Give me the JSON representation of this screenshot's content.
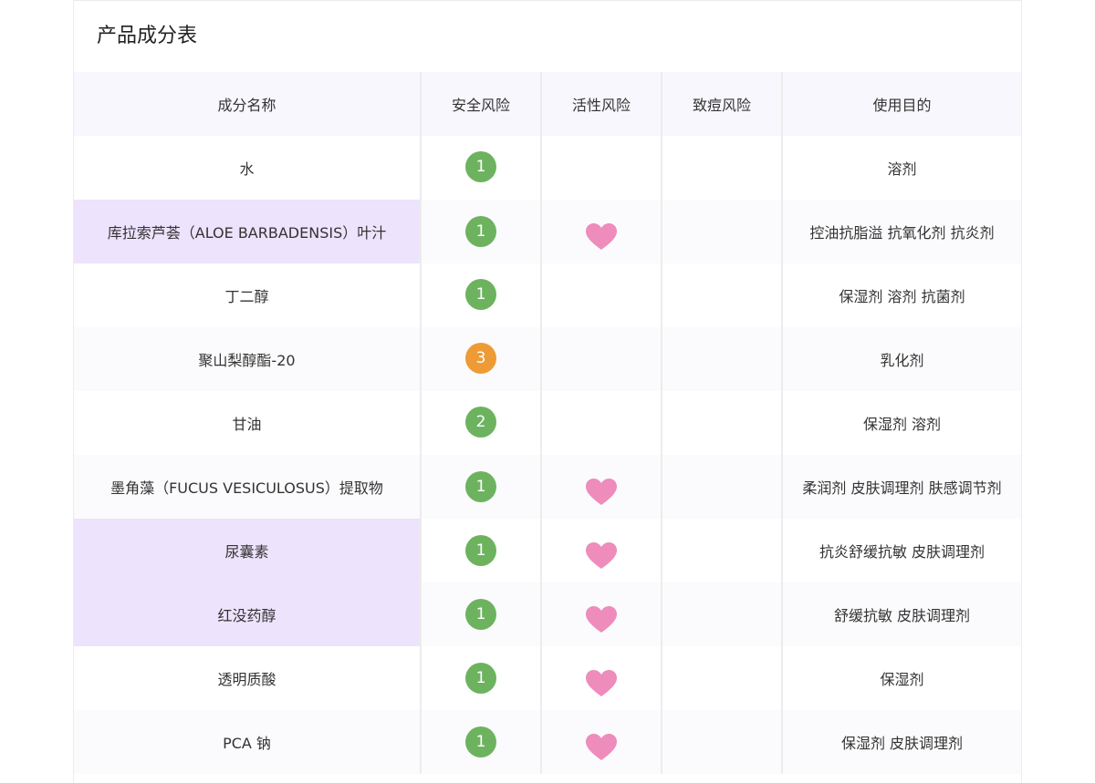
{
  "title": "产品成分表",
  "colors": {
    "header_bg": "#f9f7fe",
    "highlight_bg": "#ede3fc",
    "safe_green": "#6db35f",
    "warn_orange": "#ee9b36",
    "heart_pink": "#ee8cbb"
  },
  "headers": [
    "成分名称",
    "安全风险",
    "活性风险",
    "致痘风险",
    "使用目的"
  ],
  "rows": [
    {
      "name": "水",
      "safety": "1",
      "active": false,
      "purpose": "溶剂"
    },
    {
      "name": "库拉索芦荟（ALOE BARBADENSIS）叶汁",
      "safety": "1",
      "active": true,
      "purpose": "控油抗脂溢 抗氧化剂 抗炎剂"
    },
    {
      "name": "丁二醇",
      "safety": "1",
      "active": false,
      "purpose": "保湿剂 溶剂 抗菌剂"
    },
    {
      "name": "聚山梨醇酯-20",
      "safety": "3",
      "active": false,
      "purpose": "乳化剂"
    },
    {
      "name": "甘油",
      "safety": "2",
      "active": false,
      "purpose": "保湿剂 溶剂"
    },
    {
      "name": "墨角藻（FUCUS VESICULOSUS）提取物",
      "safety": "1",
      "active": true,
      "purpose": "柔润剂 皮肤调理剂 肤感调节剂"
    },
    {
      "name": "尿囊素",
      "safety": "1",
      "active": true,
      "purpose": "抗炎舒缓抗敏 皮肤调理剂"
    },
    {
      "name": "红没药醇",
      "safety": "1",
      "active": true,
      "purpose": "舒缓抗敏 皮肤调理剂"
    },
    {
      "name": "透明质酸",
      "safety": "1",
      "active": true,
      "purpose": "保湿剂"
    },
    {
      "name": "PCA 钠",
      "safety": "1",
      "active": true,
      "purpose": "保湿剂 皮肤调理剂"
    }
  ]
}
